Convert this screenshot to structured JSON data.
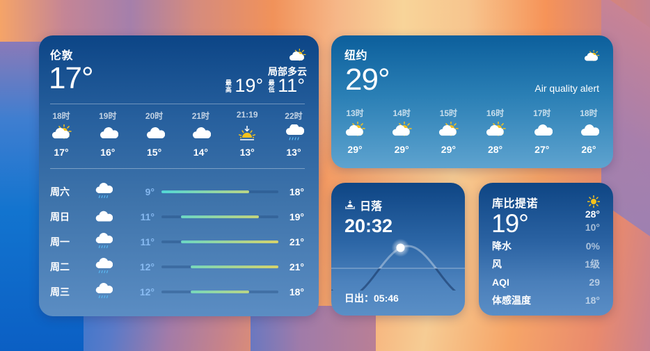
{
  "colors": {
    "sun": "#f6c21c",
    "rain": "#5ab8f2",
    "cloud": "#ffffff"
  },
  "london": {
    "city": "伦敦",
    "temperature": "17°",
    "condition": "局部多云",
    "condition_icon": "partly-cloudy-icon",
    "high_label": "最高",
    "high": "19°",
    "low_label": "最低",
    "low": "11°",
    "hourly": [
      {
        "time": "18时",
        "icon": "partly-cloudy",
        "temp": "17°"
      },
      {
        "time": "19时",
        "icon": "cloudy",
        "temp": "16°"
      },
      {
        "time": "20时",
        "icon": "cloudy",
        "temp": "15°"
      },
      {
        "time": "21时",
        "icon": "cloudy",
        "temp": "14°"
      },
      {
        "time": "21:19",
        "icon": "sunset",
        "temp": "13°"
      },
      {
        "time": "22时",
        "icon": "rain",
        "temp": "13°"
      }
    ],
    "daily_range": {
      "min": 9,
      "max": 21
    },
    "daily": [
      {
        "day": "周六",
        "icon": "rain",
        "low": "9°",
        "high": "18°",
        "low_value": 9,
        "high_value": 18
      },
      {
        "day": "周日",
        "icon": "cloudy",
        "low": "11°",
        "high": "19°",
        "low_value": 11,
        "high_value": 19
      },
      {
        "day": "周一",
        "icon": "rain",
        "low": "11°",
        "high": "21°",
        "low_value": 11,
        "high_value": 21
      },
      {
        "day": "周二",
        "icon": "rain",
        "low": "12°",
        "high": "21°",
        "low_value": 12,
        "high_value": 21
      },
      {
        "day": "周三",
        "icon": "rain",
        "low": "12°",
        "high": "18°",
        "low_value": 12,
        "high_value": 18
      }
    ]
  },
  "new_york": {
    "city": "纽约",
    "temperature": "29°",
    "condition_icon": "partly-cloudy-icon",
    "alert": "Air quality alert",
    "hourly": [
      {
        "time": "13时",
        "icon": "partly-cloudy",
        "temp": "29°"
      },
      {
        "time": "14时",
        "icon": "partly-cloudy",
        "temp": "29°"
      },
      {
        "time": "15时",
        "icon": "partly-cloudy",
        "temp": "29°"
      },
      {
        "time": "16时",
        "icon": "partly-cloudy",
        "temp": "28°"
      },
      {
        "time": "17时",
        "icon": "cloudy",
        "temp": "27°"
      },
      {
        "time": "18时",
        "icon": "cloudy",
        "temp": "26°"
      }
    ]
  },
  "sunset": {
    "label": "日落",
    "time": "20:32",
    "sunrise": "日出：05:46",
    "day_progress": 0.37
  },
  "cupertino": {
    "city": "库比提诺",
    "temperature": "19°",
    "condition_icon": "sunny-icon",
    "high": "28°",
    "low": "10°",
    "details": [
      {
        "label": "降水",
        "value": "0%"
      },
      {
        "label": "风",
        "value": "1级"
      },
      {
        "label": "AQI",
        "value": "29"
      },
      {
        "label": "体感温度",
        "value": "18°"
      }
    ]
  }
}
